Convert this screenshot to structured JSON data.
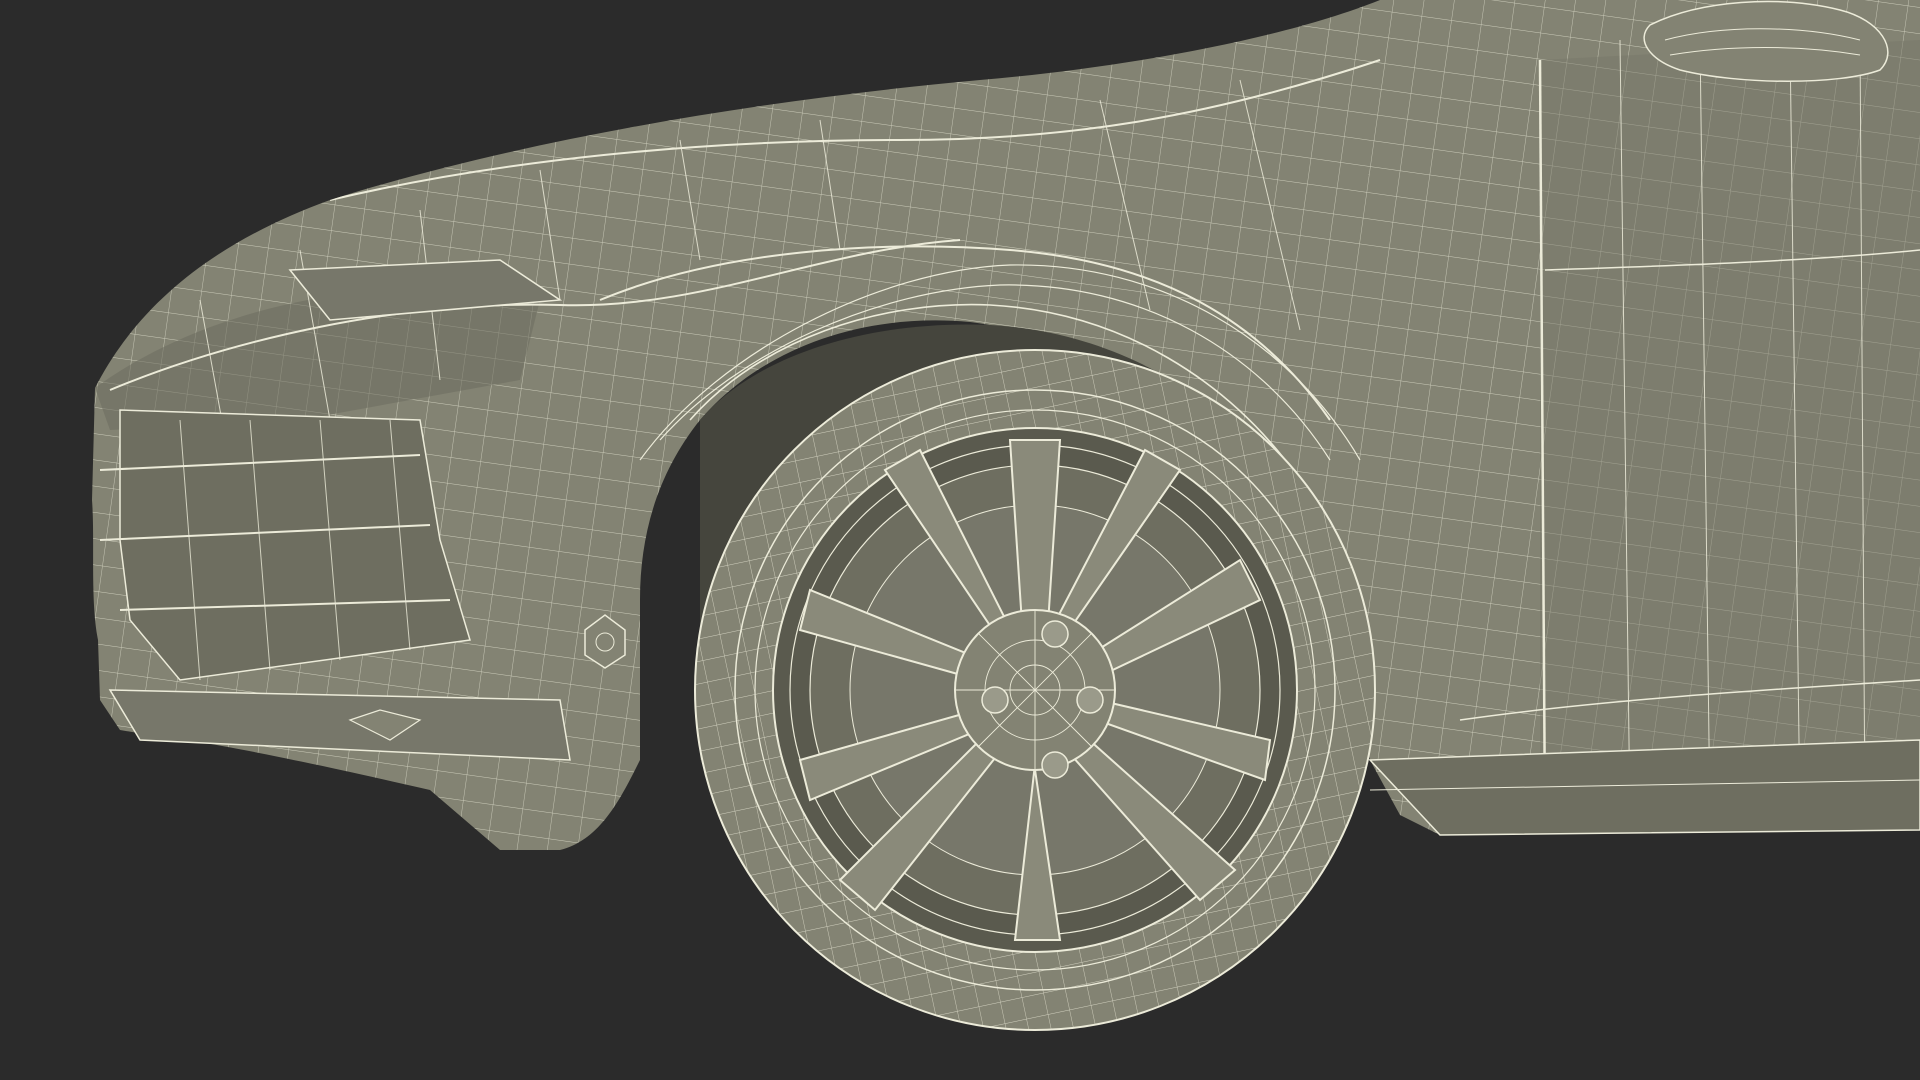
{
  "scene": {
    "subject": "car-front-wireframe",
    "colors": {
      "background": "#2b2b2b",
      "body_fill": "#838373",
      "body_shadow": "#6e6e60",
      "body_dark": "#5a5a4e",
      "wire": "#ecebd9",
      "wire_dim": "#c9c8b4"
    },
    "icons": {
      "wheel": "wheel-icon",
      "headlight": "headlight-icon",
      "mirror": "mirror-icon"
    }
  }
}
